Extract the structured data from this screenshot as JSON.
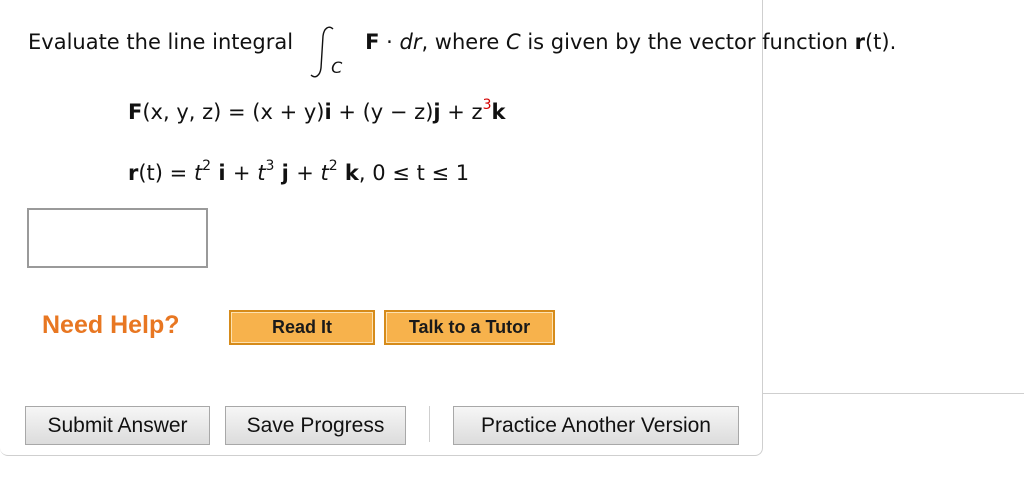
{
  "prompt": {
    "before": "Evaluate the line integral",
    "integral_sub": "C",
    "F": "F",
    "dot": " · ",
    "dr": "dr",
    "comma_where": ",  where ",
    "C": "C",
    "tail": " is given by the vector function ",
    "r": "r",
    "paren_t": "(t)."
  },
  "eq1": {
    "F": "F",
    "args": "(x, y, z)",
    "rhs1": " = (x + y)",
    "i": "i",
    "rhs2": " + (y − z)",
    "j": "j",
    "rhs3": " + z",
    "exp": "3",
    "k": "k"
  },
  "eq2": {
    "r": "r",
    "t": "(t)",
    "eq": " = ",
    "t1": "t",
    "e1": "2",
    "i": " i ",
    "plus1": "+ ",
    "t2": "t",
    "e2": "3",
    "j": " j ",
    "plus2": "+ ",
    "t3": "t",
    "e3": "2",
    "k": " k",
    "range": ",   0 ≤ t ≤ 1"
  },
  "help": {
    "label": "Need Help?",
    "read_it": "Read It",
    "tutor": "Talk to a Tutor"
  },
  "actions": {
    "submit": "Submit Answer",
    "save": "Save Progress",
    "practice": "Practice Another Version"
  },
  "colors": {
    "help_orange": "#e87722",
    "button_orange": "#f7b24c",
    "exponent_red": "#d40000"
  }
}
